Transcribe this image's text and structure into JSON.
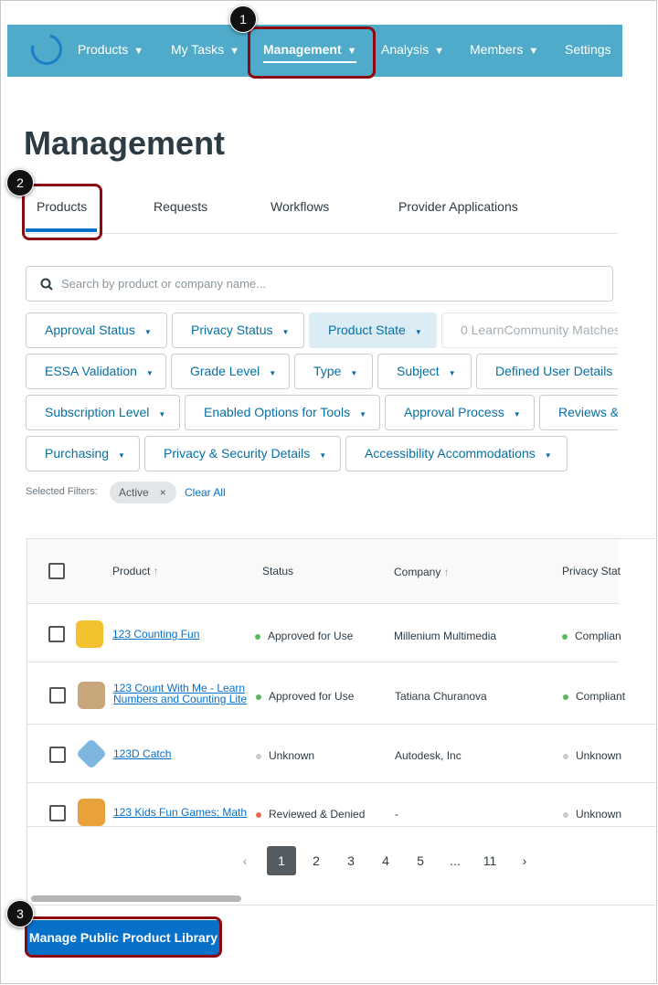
{
  "nav": {
    "items": [
      {
        "label": "Products",
        "chev": "⌄"
      },
      {
        "label": "My Tasks"
      },
      {
        "label": "Management"
      },
      {
        "label": "Analysis"
      },
      {
        "label": "Members"
      },
      {
        "label": "Settings"
      }
    ],
    "chevron": "❯"
  },
  "page_title": "Management",
  "tabs": [
    "Products",
    "Requests",
    "Workflows",
    "Provider Applications"
  ],
  "search": {
    "placeholder": "Search by product or company name..."
  },
  "filters": [
    "Approval Status",
    "Privacy Status",
    "Product State",
    "0 LearnCommunity Matches",
    "ESSA Validation",
    "Grade Level",
    "Type",
    "Subject",
    "Defined User Details",
    "Subscription Level",
    "Enabled Options for Tools",
    "Approval Process",
    "Reviews &",
    "Purchasing",
    "Privacy & Security Details",
    "Accessibility Accommodations"
  ],
  "caret": "▼",
  "selected": {
    "label": "Selected Filters:",
    "pill": "Active",
    "remove": "×",
    "clear": "Clear All"
  },
  "table": {
    "headers": [
      "Product",
      "Status",
      "Company",
      "Privacy Stat"
    ],
    "sort_arrow": "↑",
    "rows": [
      {
        "product": "123 Counting Fun",
        "status": "Approved for Use",
        "company": "Millenium Multimedia",
        "privacy": "Complian"
      },
      {
        "product": "123 Count With Me - Learn Numbers and Counting Lite",
        "product_l1": "123 Count With Me - Learn",
        "product_l2": "Numbers and Counting Lite",
        "status": "Approved for Use",
        "company": "Tatiana Churanova",
        "privacy": "Compliant"
      },
      {
        "product": "123D Catch",
        "status": "Unknown",
        "company": "Autodesk, Inc",
        "privacy": "Unknown"
      },
      {
        "product": "123 Kids Fun Games: Math",
        "status": "Reviewed & Denied",
        "company": "-",
        "privacy": "Unknown"
      }
    ]
  },
  "pagination": {
    "prev": "‹",
    "pages": [
      "1",
      "2",
      "3",
      "4",
      "5",
      "...",
      "11"
    ],
    "next": "›",
    "current": "1"
  },
  "button": "Manage Public Product Library",
  "callouts": [
    "1",
    "2",
    "3"
  ],
  "colors": {
    "nav": "#4fabc9",
    "accent": "#0770c9",
    "approved": "#5cb85c",
    "unknown": "#c7cdd1",
    "denied": "#ee6b4d",
    "callout": "#8b0a10"
  }
}
